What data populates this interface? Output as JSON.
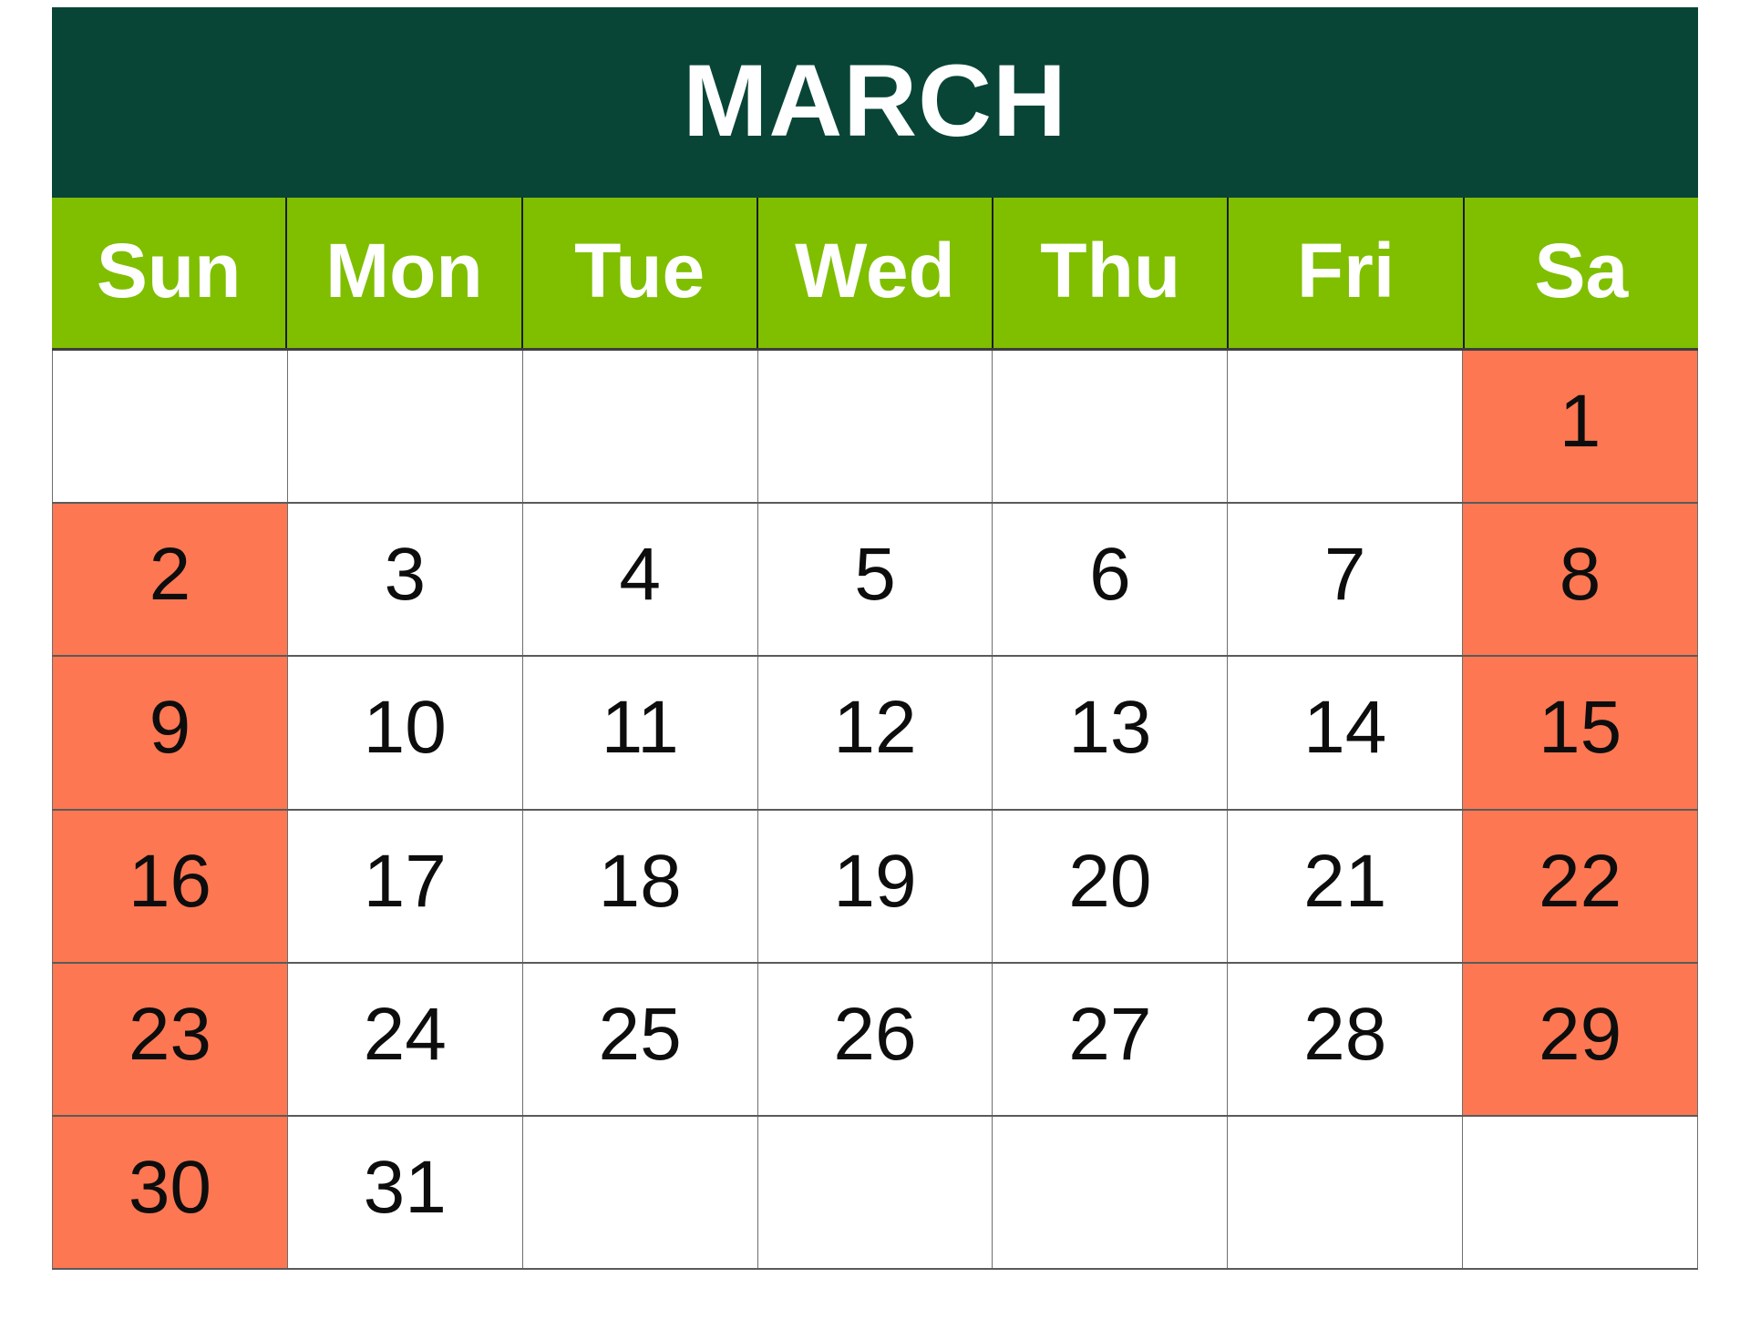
{
  "calendar": {
    "month_title": "MARCH",
    "weekday_headers": [
      "Sun",
      "Mon",
      "Tue",
      "Wed",
      "Thu",
      "Fri",
      "Sa"
    ],
    "colors": {
      "banner_background": "#084537",
      "banner_text": "#ffffff",
      "weekday_background": "#7fbf00",
      "weekday_text": "#ffffff",
      "weekend_cell_background": "#fc7752",
      "day_cell_background": "#ffffff",
      "day_number_text": "#0d0d0d",
      "grid_line": "#6e6e6e"
    },
    "weeks": [
      [
        {
          "day": "",
          "weekend": true,
          "empty": true
        },
        {
          "day": "",
          "weekend": false,
          "empty": true
        },
        {
          "day": "",
          "weekend": false,
          "empty": true
        },
        {
          "day": "",
          "weekend": false,
          "empty": true
        },
        {
          "day": "",
          "weekend": false,
          "empty": true
        },
        {
          "day": "",
          "weekend": false,
          "empty": true
        },
        {
          "day": "1",
          "weekend": true,
          "empty": false
        }
      ],
      [
        {
          "day": "2",
          "weekend": true,
          "empty": false
        },
        {
          "day": "3",
          "weekend": false,
          "empty": false
        },
        {
          "day": "4",
          "weekend": false,
          "empty": false
        },
        {
          "day": "5",
          "weekend": false,
          "empty": false
        },
        {
          "day": "6",
          "weekend": false,
          "empty": false
        },
        {
          "day": "7",
          "weekend": false,
          "empty": false
        },
        {
          "day": "8",
          "weekend": true,
          "empty": false
        }
      ],
      [
        {
          "day": "9",
          "weekend": true,
          "empty": false
        },
        {
          "day": "10",
          "weekend": false,
          "empty": false
        },
        {
          "day": "11",
          "weekend": false,
          "empty": false
        },
        {
          "day": "12",
          "weekend": false,
          "empty": false
        },
        {
          "day": "13",
          "weekend": false,
          "empty": false
        },
        {
          "day": "14",
          "weekend": false,
          "empty": false
        },
        {
          "day": "15",
          "weekend": true,
          "empty": false
        }
      ],
      [
        {
          "day": "16",
          "weekend": true,
          "empty": false
        },
        {
          "day": "17",
          "weekend": false,
          "empty": false
        },
        {
          "day": "18",
          "weekend": false,
          "empty": false
        },
        {
          "day": "19",
          "weekend": false,
          "empty": false
        },
        {
          "day": "20",
          "weekend": false,
          "empty": false
        },
        {
          "day": "21",
          "weekend": false,
          "empty": false
        },
        {
          "day": "22",
          "weekend": true,
          "empty": false
        }
      ],
      [
        {
          "day": "23",
          "weekend": true,
          "empty": false
        },
        {
          "day": "24",
          "weekend": false,
          "empty": false
        },
        {
          "day": "25",
          "weekend": false,
          "empty": false
        },
        {
          "day": "26",
          "weekend": false,
          "empty": false
        },
        {
          "day": "27",
          "weekend": false,
          "empty": false
        },
        {
          "day": "28",
          "weekend": false,
          "empty": false
        },
        {
          "day": "29",
          "weekend": true,
          "empty": false
        }
      ],
      [
        {
          "day": "30",
          "weekend": true,
          "empty": false
        },
        {
          "day": "31",
          "weekend": false,
          "empty": false
        },
        {
          "day": "",
          "weekend": false,
          "empty": true
        },
        {
          "day": "",
          "weekend": false,
          "empty": true
        },
        {
          "day": "",
          "weekend": false,
          "empty": true
        },
        {
          "day": "",
          "weekend": false,
          "empty": true
        },
        {
          "day": "",
          "weekend": false,
          "empty": true
        }
      ]
    ]
  }
}
